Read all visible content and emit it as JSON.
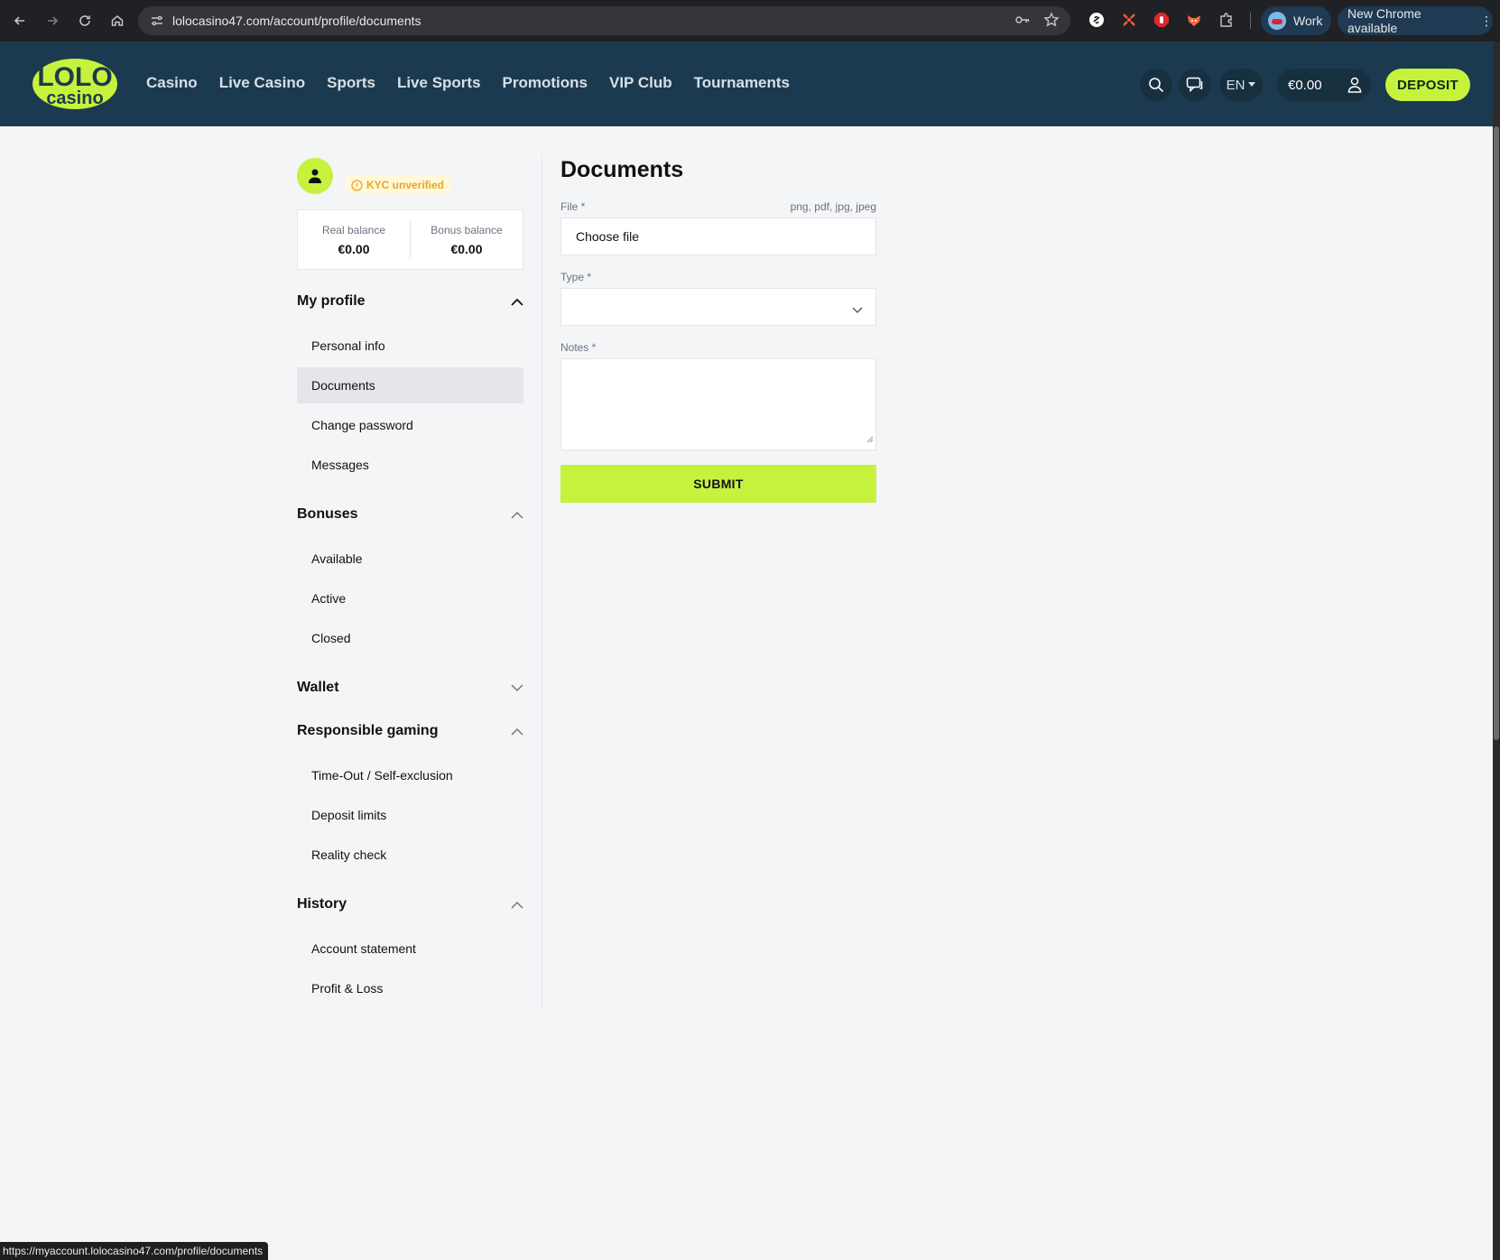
{
  "browser": {
    "url": "lolocasino47.com/account/profile/documents",
    "profile_label": "Work",
    "update_label": "New Chrome available",
    "status_url": "https://myaccount.lolocasino47.com/profile/documents"
  },
  "header": {
    "logo_top": "LOLO",
    "logo_bottom": "casino",
    "nav": [
      "Casino",
      "Live Casino",
      "Sports",
      "Live Sports",
      "Promotions",
      "VIP Club",
      "Tournaments"
    ],
    "language": "EN",
    "balance": "€0.00",
    "deposit_label": "DEPOSIT"
  },
  "sidebar": {
    "kyc_status": "KYC unverified",
    "real_balance_label": "Real balance",
    "real_balance_value": "€0.00",
    "bonus_balance_label": "Bonus balance",
    "bonus_balance_value": "€0.00",
    "sections": [
      {
        "title": "My profile",
        "expanded": true,
        "items": [
          "Personal info",
          "Documents",
          "Change password",
          "Messages"
        ],
        "active": "Documents"
      },
      {
        "title": "Bonuses",
        "expanded": true,
        "items": [
          "Available",
          "Active",
          "Closed"
        ]
      },
      {
        "title": "Wallet",
        "expanded": false,
        "items": []
      },
      {
        "title": "Responsible gaming",
        "expanded": true,
        "items": [
          "Time-Out / Self-exclusion",
          "Deposit limits",
          "Reality check"
        ]
      },
      {
        "title": "History",
        "expanded": true,
        "items": [
          "Account statement",
          "Profit & Loss"
        ]
      }
    ]
  },
  "main": {
    "title": "Documents",
    "file_label": "File *",
    "file_hint": "png, pdf, jpg, jpeg",
    "file_button": "Choose file",
    "type_label": "Type *",
    "type_value": "",
    "notes_label": "Notes *",
    "notes_value": "",
    "submit_label": "SUBMIT"
  },
  "colors": {
    "accent": "#c6f23e",
    "header_bg": "#1c3a4f",
    "kyc_warning": "#e7a72a"
  }
}
